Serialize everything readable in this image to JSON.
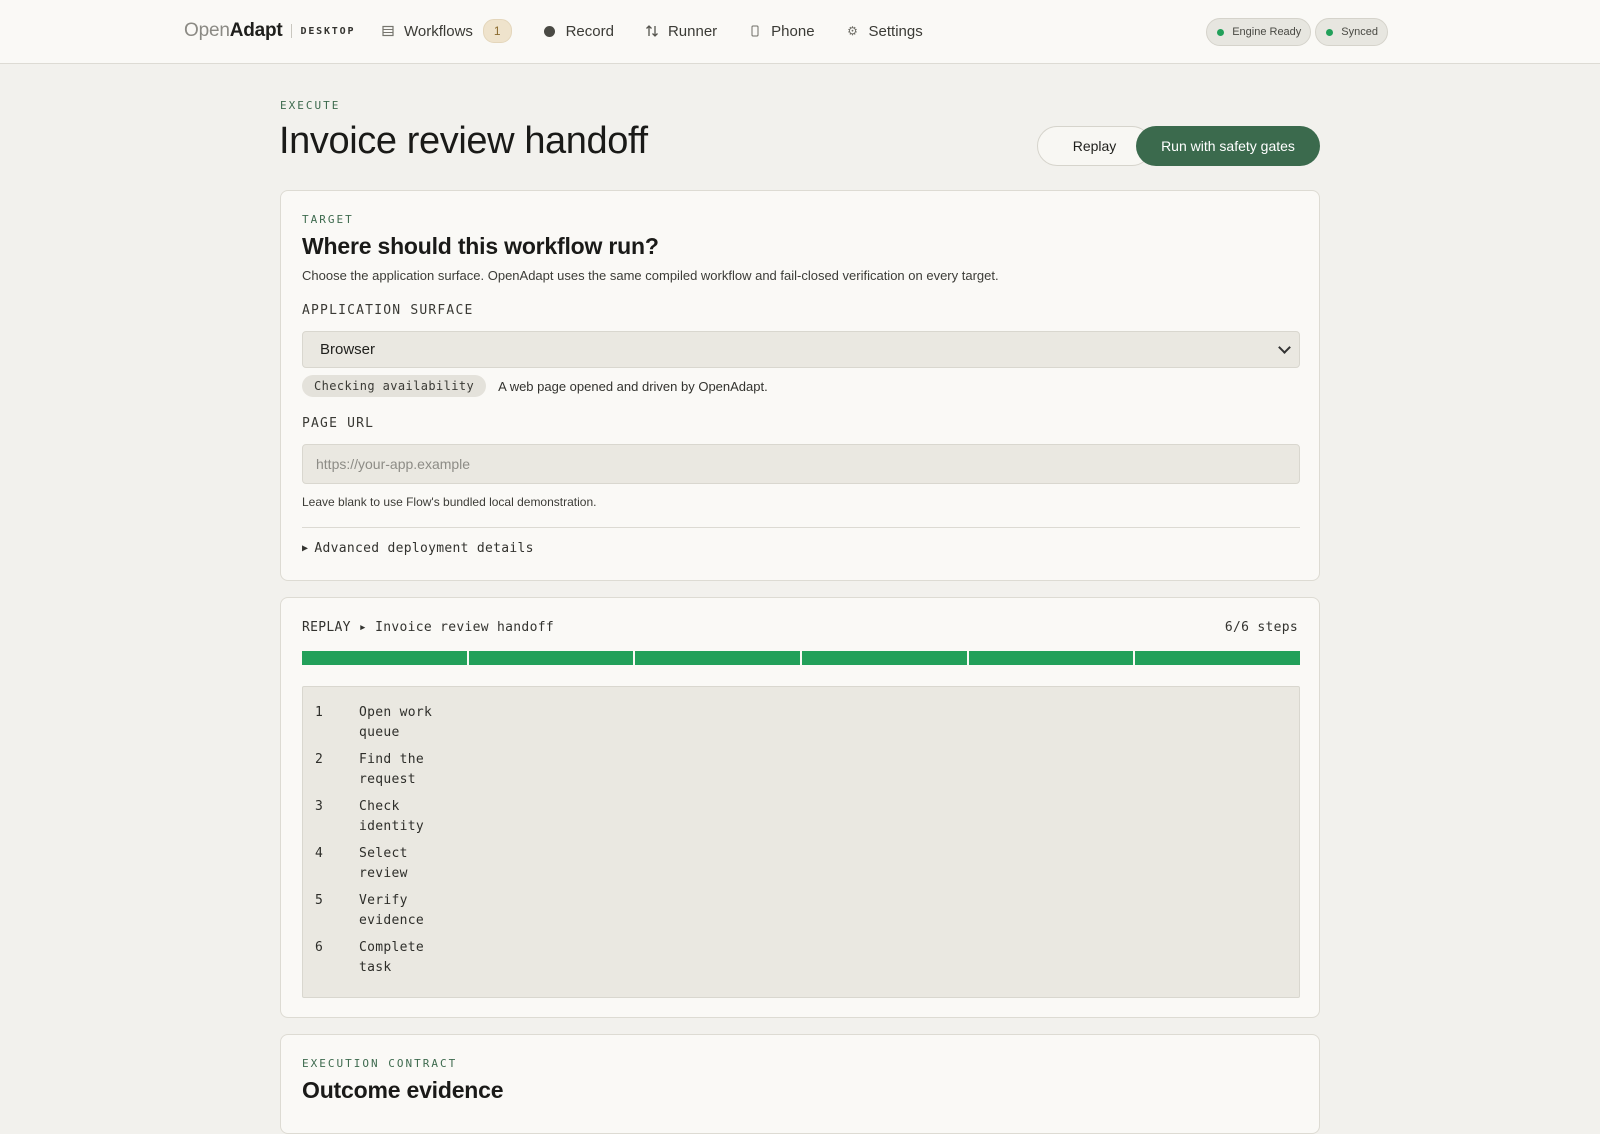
{
  "brand": {
    "open": "Open",
    "adapt": "Adapt",
    "edition": "DESKTOP"
  },
  "nav": {
    "items": [
      {
        "label": "Workflows",
        "icon": "list-icon",
        "badge": "1"
      },
      {
        "label": "Record",
        "icon": "record-dot-icon"
      },
      {
        "label": "Runner",
        "icon": "transfer-arrows-icon"
      },
      {
        "label": "Phone",
        "icon": "phone-icon"
      },
      {
        "label": "Settings",
        "icon": "gear-icon"
      }
    ]
  },
  "status": {
    "engine": "Engine Ready",
    "sync": "Synced",
    "ok_color": "#22a05a"
  },
  "header": {
    "eyebrow": "EXECUTE",
    "title": "Invoice review handoff",
    "replay_label": "Replay",
    "run_label": "Run with safety gates"
  },
  "target": {
    "eyebrow": "TARGET",
    "title": "Where should this workflow run?",
    "description": "Choose the application surface. OpenAdapt uses the same compiled workflow and fail-closed verification on every target.",
    "surface_label": "APPLICATION SURFACE",
    "surface_value": "Browser",
    "availability": "Checking availability",
    "surface_hint": "A web page opened and driven by OpenAdapt.",
    "url_label": "PAGE URL",
    "url_placeholder": "https://your-app.example",
    "url_value": "",
    "url_hint": "Leave blank to use Flow's bundled local demonstration.",
    "advanced": "Advanced deployment details"
  },
  "replay": {
    "prefix": "REPLAY ▸",
    "title": "Invoice review handoff",
    "progress_text": "6/6 steps",
    "completed": 6,
    "total": 6,
    "progress_color": "#22a05a",
    "steps": [
      {
        "num": "1",
        "label": "Open work queue"
      },
      {
        "num": "2",
        "label": "Find the request"
      },
      {
        "num": "3",
        "label": "Check identity"
      },
      {
        "num": "4",
        "label": "Select review"
      },
      {
        "num": "5",
        "label": "Verify evidence"
      },
      {
        "num": "6",
        "label": "Complete task"
      }
    ]
  },
  "contract": {
    "eyebrow": "EXECUTION CONTRACT",
    "title": "Outcome evidence"
  },
  "colors": {
    "accent": "#3b6a4d",
    "background": "#f2f1ed",
    "card": "#faf9f6"
  }
}
